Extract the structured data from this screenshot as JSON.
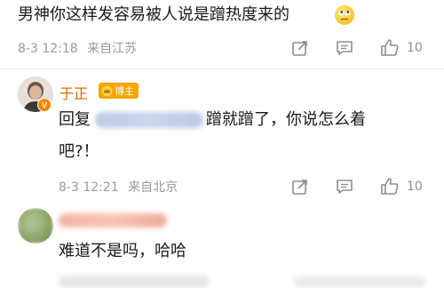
{
  "comment1": {
    "text": "男神你这样发容易被人说是蹭热度来的",
    "emoji_name": "rolling-eyes-emoji",
    "date": "8-3 12:18",
    "location": "来自江苏",
    "likes": "10"
  },
  "comment2": {
    "username": "于正",
    "badge_label": "博主",
    "reply_prefix": "回复",
    "text_after_mention": "蹭就蹭了，你说怎么着",
    "text_line2": "吧?！",
    "date": "8-3 12:21",
    "location": "来自北京",
    "likes": "10"
  },
  "comment3": {
    "text": "难道不是吗，哈哈"
  },
  "icons": {
    "share": "share-icon",
    "reply": "comment-icon",
    "like": "thumbs-up-icon"
  },
  "colors": {
    "badge_orange": "#f7a400",
    "meta_gray": "#9a9a9a",
    "vip_badge_orange": "#ff8200"
  }
}
